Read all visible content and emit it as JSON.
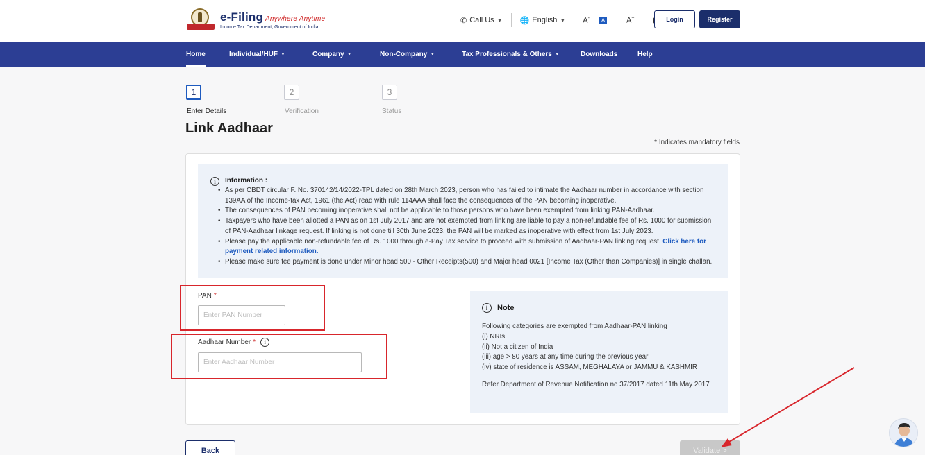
{
  "header": {
    "logo_title": "e-Filing",
    "logo_tagline": "Anywhere Anytime",
    "logo_subtitle": "Income Tax Department, Government of India",
    "call_us": "Call Us",
    "language": "English",
    "font_decrease": "A",
    "font_normal": "A",
    "font_increase": "A",
    "login": "Login",
    "register": "Register"
  },
  "nav": {
    "items": [
      {
        "label": "Home"
      },
      {
        "label": "Individual/HUF"
      },
      {
        "label": "Company"
      },
      {
        "label": "Non-Company"
      },
      {
        "label": "Tax Professionals & Others"
      },
      {
        "label": "Downloads"
      },
      {
        "label": "Help"
      }
    ]
  },
  "stepper": {
    "steps": [
      {
        "number": "1",
        "label": "Enter Details"
      },
      {
        "number": "2",
        "label": "Verification"
      },
      {
        "number": "3",
        "label": "Status"
      }
    ]
  },
  "page": {
    "title": "Link Aadhaar",
    "mandatory_note": "* Indicates mandatory fields"
  },
  "info": {
    "heading": "Information :",
    "items": [
      "As per CBDT circular F. No. 370142/14/2022-TPL dated on 28th March 2023, person who has failed to intimate the Aadhaar number in accordance with section 139AA of the Income-tax Act, 1961 (the Act) read with rule 114AAA shall face the consequences of the PAN becoming inoperative.",
      "The consequences of PAN becoming inoperative shall not be applicable to those persons who have been exempted from linking PAN-Aadhaar.",
      "Taxpayers who have been allotted a PAN as on 1st July 2017 and are not exempted from linking are liable to pay a non-refundable fee of Rs. 1000 for submission of PAN-Aadhaar linkage request. If linking is not done till 30th June 2023, the PAN will be marked as inoperative with effect from 1st July 2023.",
      "Please make sure fee payment is done under Minor head 500 - Other Receipts(500) and Major head 0021 [Income Tax (Other than Companies)] in single challan."
    ],
    "fee_item_text": "Please pay the applicable non-refundable fee of Rs. 1000 through e-Pay Tax service to proceed with submission of Aadhaar-PAN linking request.",
    "fee_item_link": "Click here for payment related information."
  },
  "form": {
    "pan_label": "PAN",
    "pan_placeholder": "Enter PAN Number",
    "aadhaar_label": "Aadhaar Number",
    "aadhaar_placeholder": "Enter Aadhaar Number",
    "required_mark": "*"
  },
  "note": {
    "title": "Note",
    "lines": [
      "Following categories are exempted from Aadhaar-PAN linking",
      "(i) NRIs",
      "(ii) Not a citizen of India",
      "(iii) age > 80 years at any time during the previous year",
      "(iv) state of residence is ASSAM, MEGHALAYA or JAMMU & KASHMIR"
    ],
    "footer": "Refer Department of Revenue Notification no 37/2017 dated 11th May 2017"
  },
  "actions": {
    "back": "Back",
    "validate": "Validate >"
  },
  "colors": {
    "nav_bg": "#2c3e94",
    "brand": "#1b2e6b",
    "highlight_red": "#d8262c",
    "info_bg": "#edf2f9"
  }
}
